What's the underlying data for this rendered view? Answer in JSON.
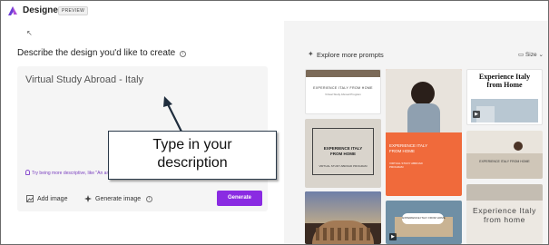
{
  "header": {
    "title": "Designer",
    "badge": "PREVIEW"
  },
  "prompt": {
    "heading": "Describe the design you'd like to create",
    "value": "Virtual Study Abroad - Italy",
    "hint": "Try being more descriptive, like \"An animated Valentine's Day post in red and pink.\"",
    "add_image": "Add image",
    "generate_image": "Generate image",
    "generate": "Generate"
  },
  "callout": {
    "line1": "Type in your",
    "line2": "description"
  },
  "explore": {
    "label": "Explore more prompts",
    "size": "Size"
  },
  "cards": [
    {
      "title": "EXPERIENCE ITALY FROM HOME",
      "sub": "Virtual Study Abroad Program"
    },
    {
      "title": "EXPERIENCE ITALY FROM HOME",
      "sub": "VIRTUAL STUDY ABROAD PROGRAM"
    },
    {
      "title": "EXPERIENCE ITALY FROM HOME",
      "sub": "VIRTUAL STUDY ABROAD PROGRAM"
    },
    {
      "title": "Experience Italy from Home"
    },
    {
      "title": "EXPERIENCE ITALY FROM HOME"
    },
    {
      "title": "Experience Italy from home"
    },
    {
      "title": "EXPERIENCE ITALY FROM HOME"
    }
  ],
  "colors": {
    "accent": "#8a2be2",
    "orange_card": "#f06a3b"
  }
}
